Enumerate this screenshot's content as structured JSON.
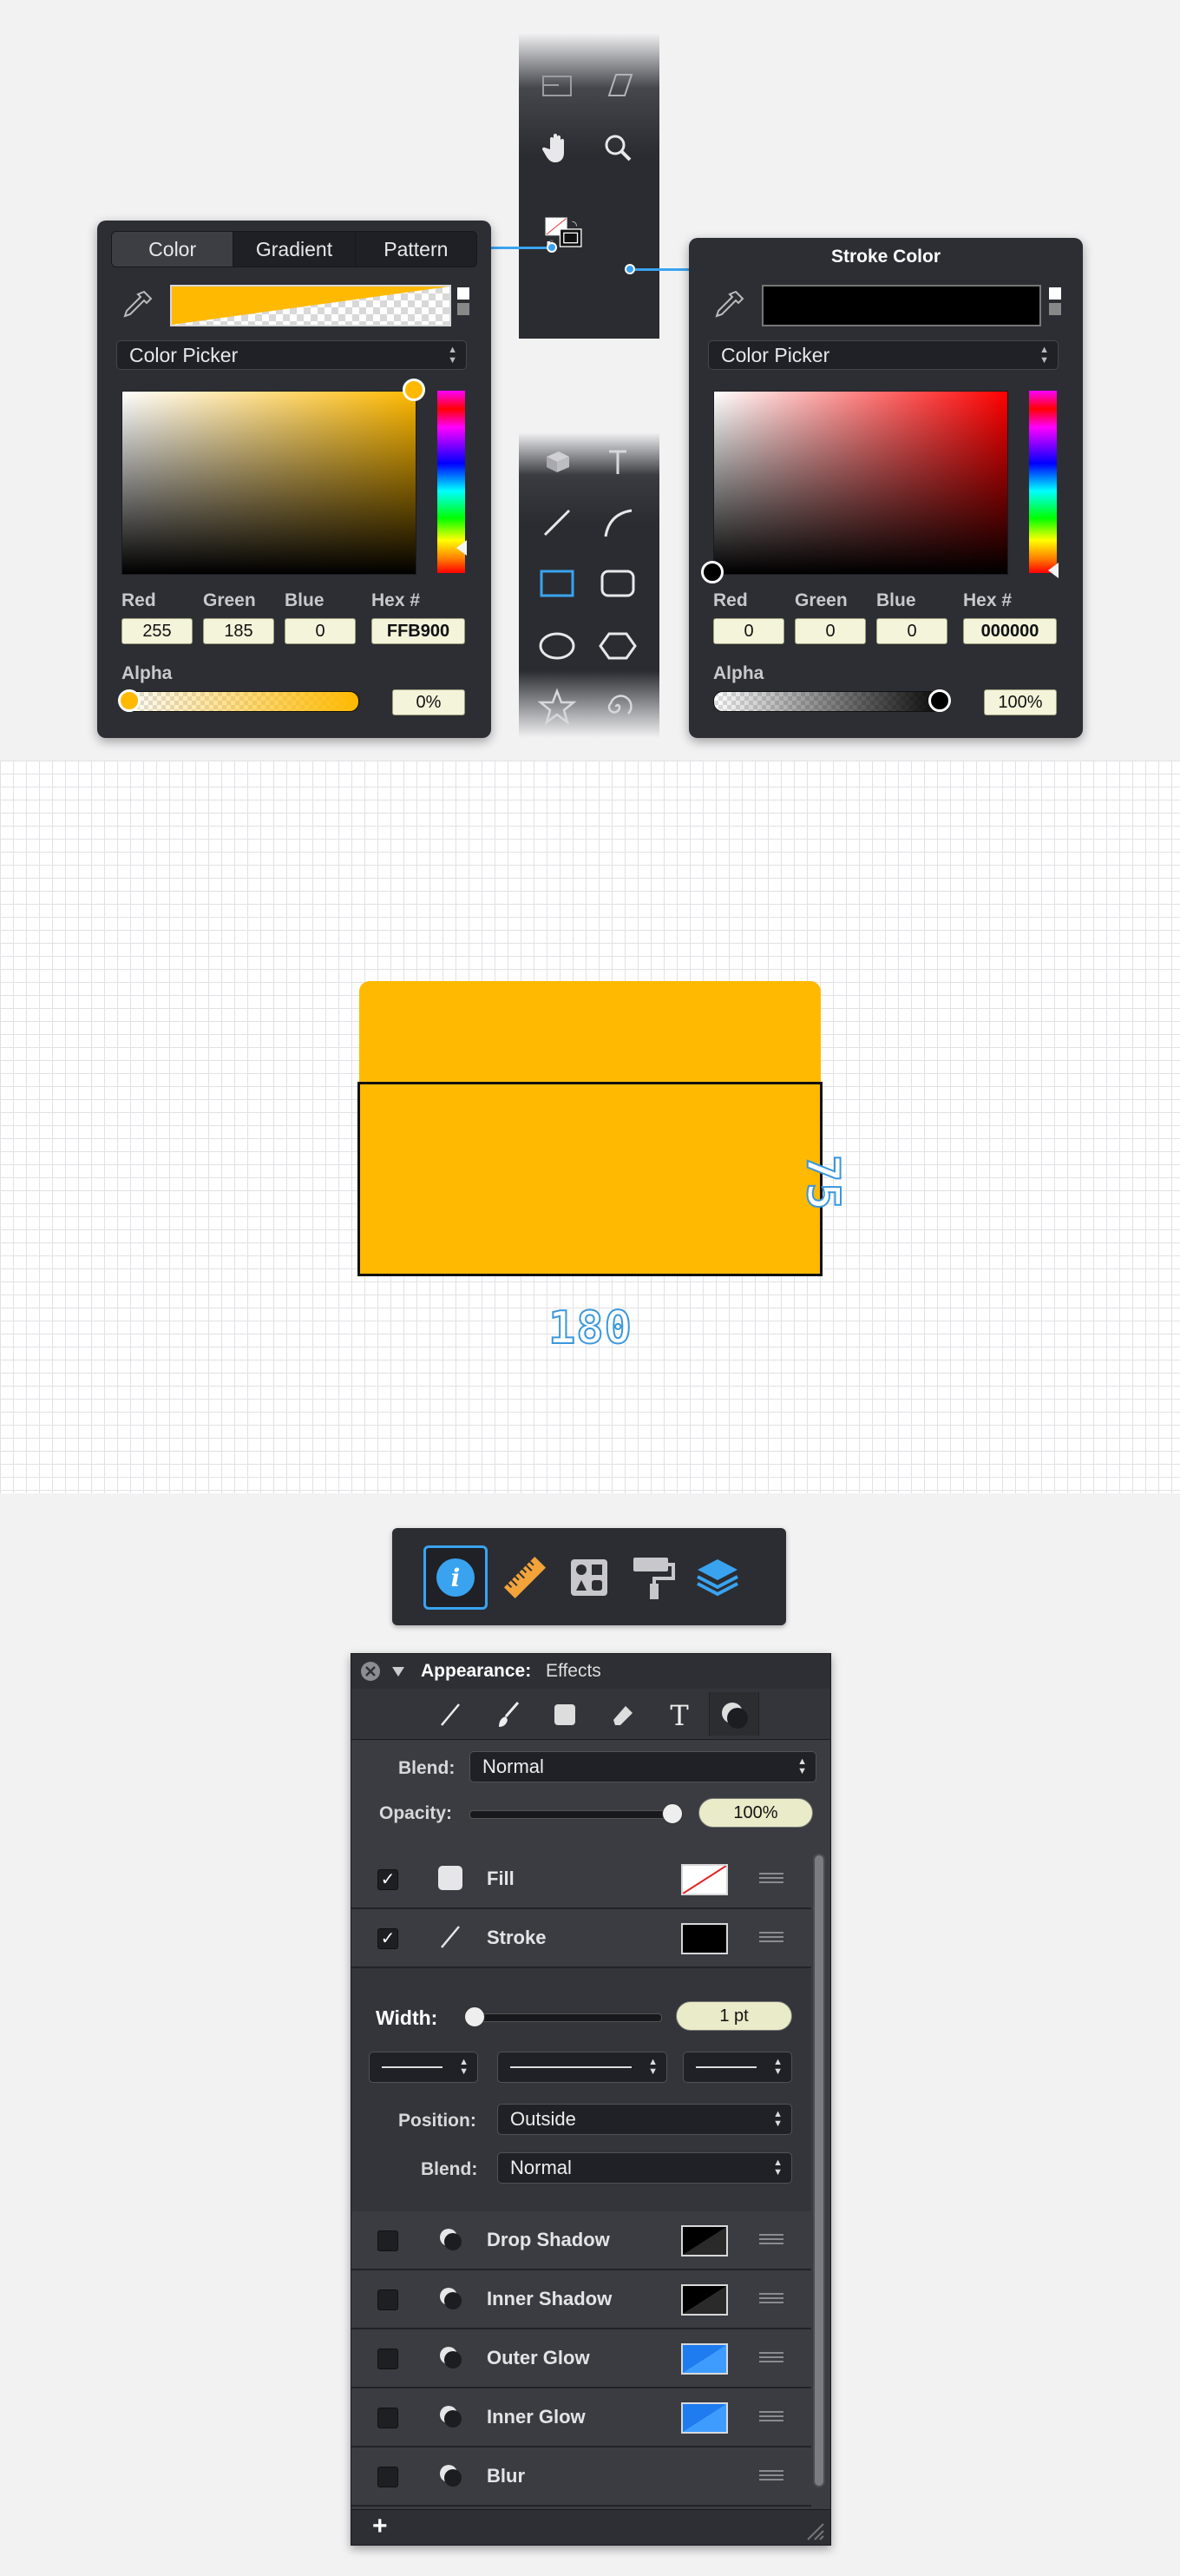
{
  "color_panel": {
    "tabs": [
      "Color",
      "Gradient",
      "Pattern"
    ],
    "active_tab": 0,
    "mode": "Color Picker",
    "labels": {
      "red": "Red",
      "green": "Green",
      "blue": "Blue",
      "hex": "Hex #",
      "alpha": "Alpha"
    },
    "red": "255",
    "green": "185",
    "blue": "0",
    "hex": "FFB900",
    "alpha": "0%",
    "color": "#FFB900"
  },
  "stroke_panel": {
    "title": "Stroke Color",
    "mode": "Color Picker",
    "labels": {
      "red": "Red",
      "green": "Green",
      "blue": "Blue",
      "hex": "Hex #",
      "alpha": "Alpha"
    },
    "red": "0",
    "green": "0",
    "blue": "0",
    "hex": "000000",
    "alpha": "100%",
    "color": "#000000"
  },
  "toolbar": {
    "top_tools": [
      "frame-tool-icon",
      "skew-tool-icon",
      "hand-tool-icon",
      "zoom-tool-icon",
      "fill-stroke-swatch-icon"
    ],
    "bottom_tools": [
      "3d-tool-icon",
      "text-tool-icon",
      "line-tool-icon",
      "arc-tool-icon",
      "rectangle-tool-icon",
      "rounded-rectangle-tool-icon",
      "ellipse-tool-icon",
      "polygon-tool-icon",
      "star-tool-icon",
      "spiral-tool-icon"
    ]
  },
  "canvas": {
    "width_label": "180",
    "height_label": "75",
    "fill_color": "#FFB900"
  },
  "inspector_tabs": [
    "info-icon",
    "ruler-icon",
    "shapes-icon",
    "paint-roller-icon",
    "layers-icon"
  ],
  "appearance": {
    "title": "Appearance:",
    "subtitle": "Effects",
    "blend_label": "Blend:",
    "blend_value": "Normal",
    "opacity_label": "Opacity:",
    "opacity_value": "100%",
    "fill_label": "Fill",
    "stroke_label": "Stroke",
    "width_label": "Width:",
    "width_value": "1 pt",
    "position_label": "Position:",
    "position_value": "Outside",
    "stroke_blend_label": "Blend:",
    "stroke_blend_value": "Normal",
    "effects": [
      {
        "name": "Drop Shadow",
        "checked": false
      },
      {
        "name": "Inner Shadow",
        "checked": false
      },
      {
        "name": "Outer Glow",
        "checked": false
      },
      {
        "name": "Inner Glow",
        "checked": false
      },
      {
        "name": "Blur",
        "checked": false
      }
    ],
    "add_label": "+"
  }
}
